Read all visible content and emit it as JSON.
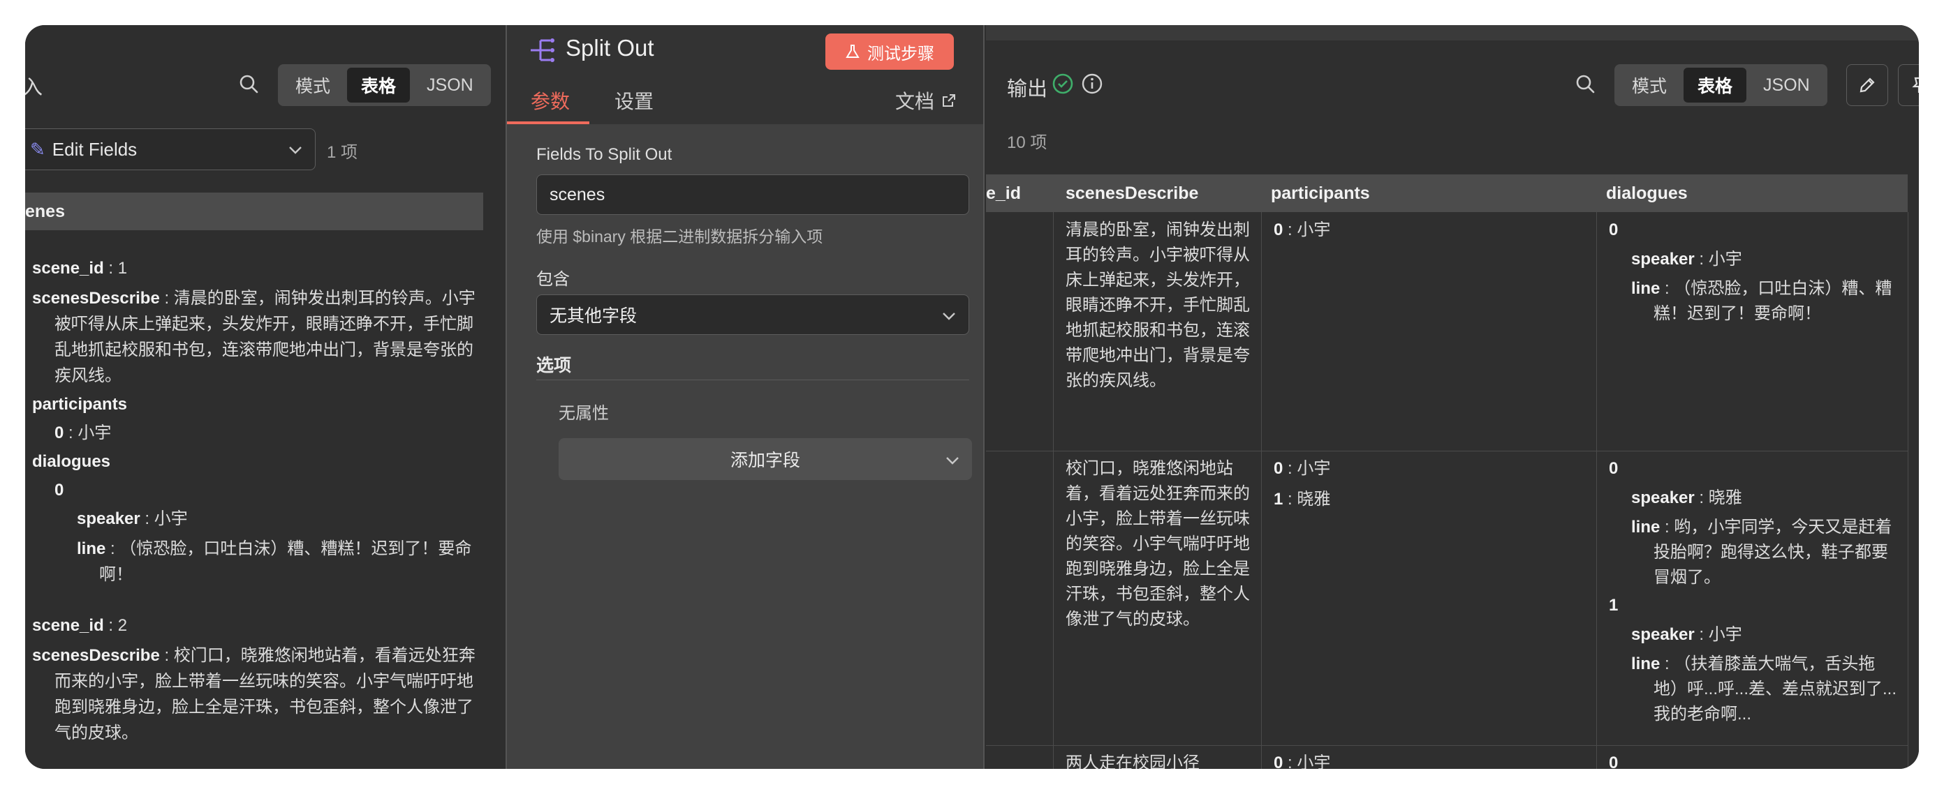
{
  "input_panel": {
    "title": "入",
    "view_modes": [
      "模式",
      "表格",
      "JSON"
    ],
    "active_mode": "表格",
    "node_select": "Edit Fields",
    "item_count": "1 项",
    "column_header": "enes",
    "tree": {
      "scene1": {
        "scene_id_key": "scene_id",
        "scene_id_val": "1",
        "describe_key": "scenesDescribe",
        "describe_val": "清晨的卧室，闹钟发出刺耳的铃声。小宇被吓得从床上弹起来，头发炸开，眼睛还睁不开，手忙脚乱地抓起校服和书包，连滚带爬地冲出门，背景是夸张的疾风线。",
        "participants_key": "participants",
        "participant_0_key": "0",
        "participant_0_val": "小宇",
        "dialogues_key": "dialogues",
        "dialogue_0_key": "0",
        "speaker_key": "speaker",
        "speaker_val": "小宇",
        "line_key": "line",
        "line_val": "（惊恐脸，口吐白沫）糟、糟糕！迟到了！要命啊！"
      },
      "scene2": {
        "scene_id_key": "scene_id",
        "scene_id_val": "2",
        "describe_key": "scenesDescribe",
        "describe_val": "校门口，晓雅悠闲地站着，看着远处狂奔而来的小宇，脸上带着一丝玩味的笑容。小宇气喘吁吁地跑到晓雅身边，脸上全是汗珠，书包歪斜，整个人像泄了气的皮球。"
      }
    }
  },
  "params_panel": {
    "node_title": "Split Out",
    "test_button": "测试步骤",
    "tabs": [
      "参数",
      "设置"
    ],
    "active_tab": "参数",
    "docs_link": "文档",
    "fields_label": "Fields To Split Out",
    "fields_value": "scenes",
    "fields_hint": "使用 $binary 根据二进制数据拆分输入项",
    "include_label": "包含",
    "include_value": "无其他字段",
    "options_title": "选项",
    "no_properties": "无属性",
    "add_field": "添加字段"
  },
  "output_panel": {
    "title": "输出",
    "view_modes": [
      "模式",
      "表格",
      "JSON"
    ],
    "active_mode": "表格",
    "item_count": "10 项",
    "columns": [
      "e_id",
      "scenesDescribe",
      "participants",
      "dialogues"
    ],
    "rows": [
      {
        "scenesDescribe": "清晨的卧室，闹钟发出刺耳的铃声。小宇被吓得从床上弹起来，头发炸开，眼睛还睁不开，手忙脚乱地抓起校服和书包，连滚带爬地冲出门，背景是夸张的疾风线。",
        "participants": [
          {
            "k": "0",
            "v": "小宇"
          }
        ],
        "dialogues": [
          {
            "idx": "0",
            "speaker": "小宇",
            "line": "（惊恐脸，口吐白沫）糟、糟糕！迟到了！要命啊！"
          }
        ]
      },
      {
        "scenesDescribe": "校门口，晓雅悠闲地站着，看着远处狂奔而来的小宇，脸上带着一丝玩味的笑容。小宇气喘吁吁地跑到晓雅身边，脸上全是汗珠，书包歪斜，整个人像泄了气的皮球。",
        "participants": [
          {
            "k": "0",
            "v": "小宇"
          },
          {
            "k": "1",
            "v": "晓雅"
          }
        ],
        "dialogues": [
          {
            "idx": "0",
            "speaker": "晓雅",
            "line": "哟，小宇同学，今天又是赶着投胎啊？跑得这么快，鞋子都要冒烟了。"
          },
          {
            "idx": "1",
            "speaker": "小宇",
            "line": "（扶着膝盖大喘气，舌头拖地）呼...呼...差、差点就迟到了...我的老命啊..."
          }
        ]
      },
      {
        "scenesDescribe": "两人走在校园小径",
        "participants": [
          {
            "k": "0",
            "v": "小宇"
          }
        ],
        "dialogues": [
          {
            "idx": "0"
          }
        ]
      }
    ],
    "keys": {
      "speaker": "speaker",
      "line": "line"
    }
  },
  "colors": {
    "accent": "#ef6b5c",
    "success": "#3fae6a",
    "background": "#2e2e2e"
  }
}
